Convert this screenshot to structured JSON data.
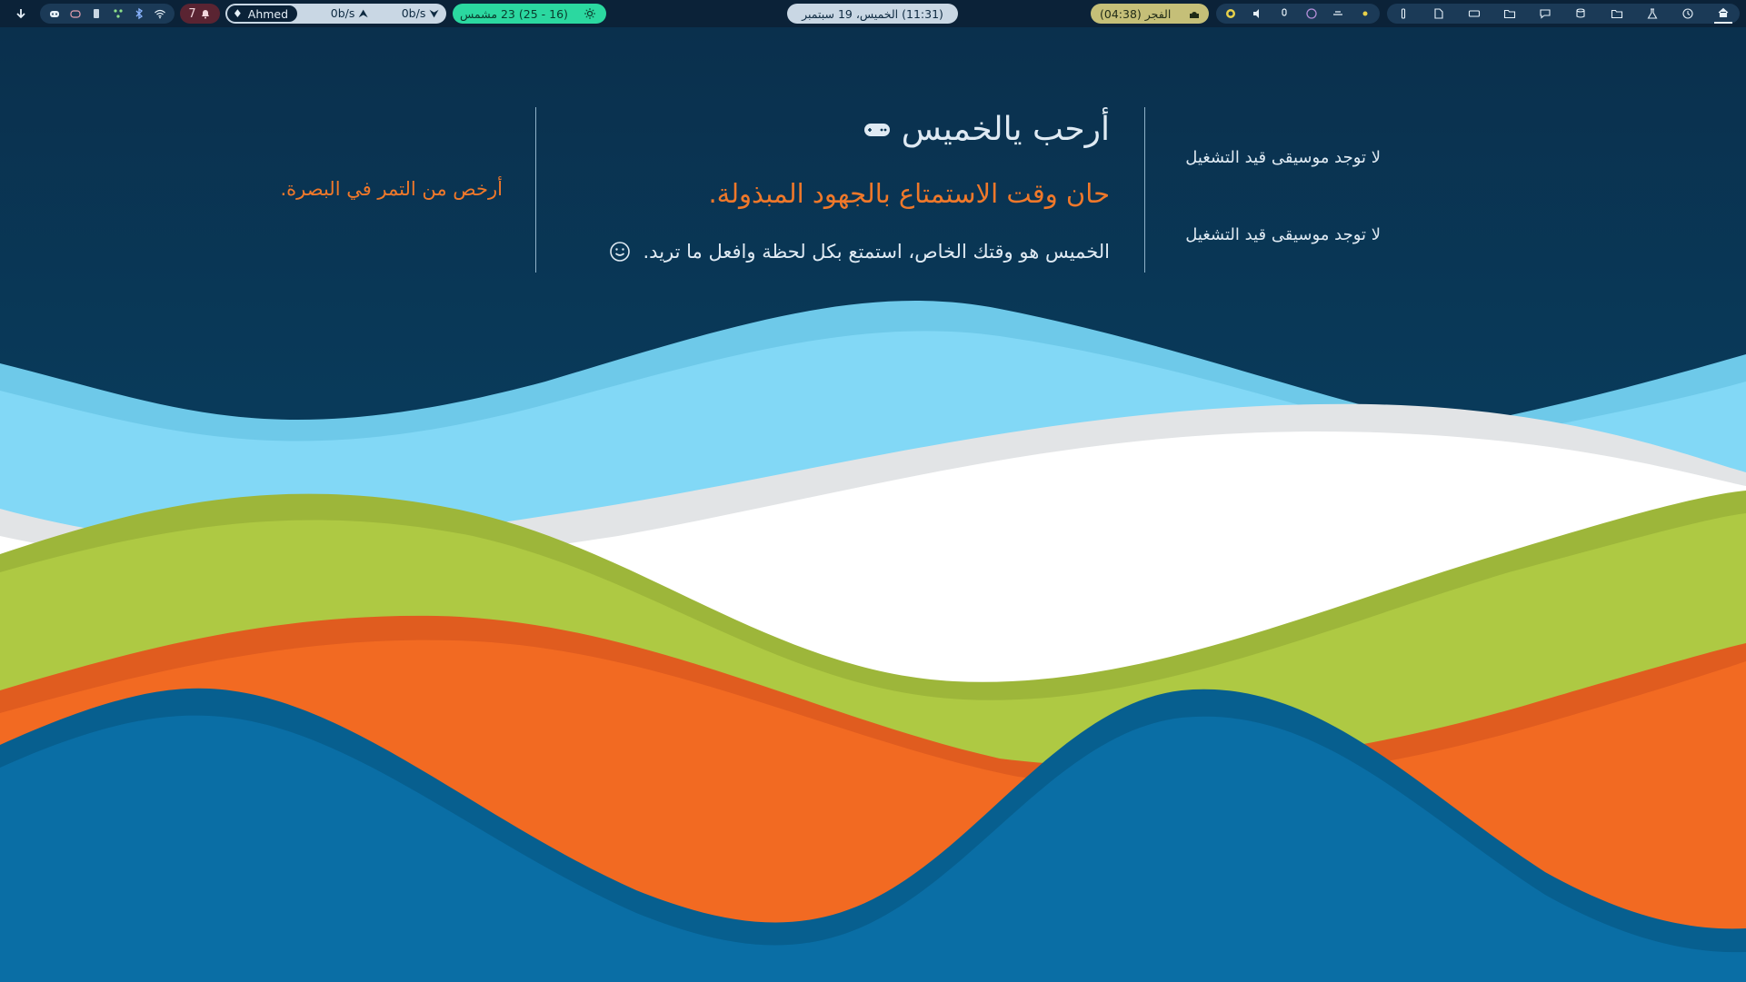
{
  "topbar": {
    "notifications_count": "7",
    "network": {
      "user": "Ahmed",
      "upload": "0b/s",
      "download": "0b/s"
    },
    "weather": {
      "text": "(16 - 25) 23 مشمس",
      "icon": "sun-icon"
    },
    "datetime": "(11:31) الخميس، 19 سبتمبر",
    "prayer": {
      "label": "الفجر (04:38)",
      "icon": "mosque-icon"
    },
    "sys_icons": [
      "discord-icon",
      "gamepad-icon",
      "phone-icon",
      "network-share-icon",
      "bluetooth-icon",
      "wifi-icon"
    ],
    "media_icons": [
      "obs-icon",
      "volume-icon",
      "mic-icon",
      "circle-icon",
      "vpn-icon",
      "dot-icon"
    ],
    "app_icons": [
      "text-cursor-icon",
      "document-icon",
      "keyboard-icon",
      "folder-image-icon",
      "chat-icon",
      "database-icon",
      "folder-icon",
      "flask-icon",
      "clock-icon",
      "home-icon"
    ]
  },
  "widget": {
    "greeting_title": "أرحب يالخميس",
    "subtitle": "حان وقت الاستمتاع بالجهود المبذولة.",
    "message": "الخميس هو وقتك الخاص، استمتع بكل لحظة وافعل ما تريد.",
    "music_line_1": "لا توجد موسيقى قيد التشغيل",
    "music_line_2": "لا توجد موسيقى قيد التشغيل",
    "side_note": "أرخص من التمر في البصرة."
  },
  "colors": {
    "background_top": "#08324f",
    "wave_light_blue": "#7fd6f3",
    "wave_white": "#f3f3f3",
    "wave_green": "#aac43f",
    "wave_orange": "#f0641f",
    "wave_blue": "#0870a3",
    "accent_orange": "#f0782a",
    "text_light": "#dfeaf3"
  }
}
